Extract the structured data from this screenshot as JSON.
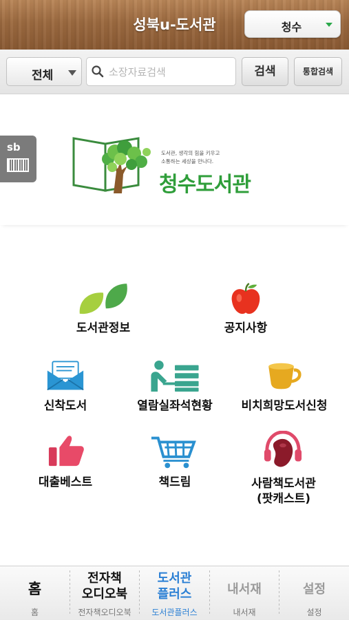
{
  "header": {
    "title": "성북u-도서관",
    "branch_select": "청수"
  },
  "search": {
    "scope_select": "전체",
    "placeholder": "소장자료검색",
    "search_button": "검색",
    "unified_button": "통합검색"
  },
  "banner": {
    "badge_text": "sb",
    "slogan_line1": "도서관, 생각의 힘을 키우고",
    "slogan_line2": "소통하는 세상을 만나다.",
    "library_name": "청수도서관"
  },
  "menu": {
    "library_info": "도서관정보",
    "notices": "공지사항",
    "new_books": "신착도서",
    "reading_room": "열람실좌석현황",
    "wish_books": "비치희망도서신청",
    "best_loans": "대출베스트",
    "book_dream": "책드림",
    "human_library_line1": "사람책도서관",
    "human_library_line2": "(팟캐스트)"
  },
  "tabs": [
    {
      "main": "홈",
      "sub": "홈"
    },
    {
      "main_line1": "전자책",
      "main_line2": "오디오북",
      "sub": "전자책오디오북"
    },
    {
      "main_line1": "도서관",
      "main_line2": "플러스",
      "sub": "도서관플러스"
    },
    {
      "main": "내서재",
      "sub": "내서재"
    },
    {
      "main": "설정",
      "sub": "설정"
    }
  ],
  "colors": {
    "brand_green": "#2f9e3a",
    "active_tab": "#2a7fd4",
    "inactive_tab": "#9a9a9a"
  }
}
